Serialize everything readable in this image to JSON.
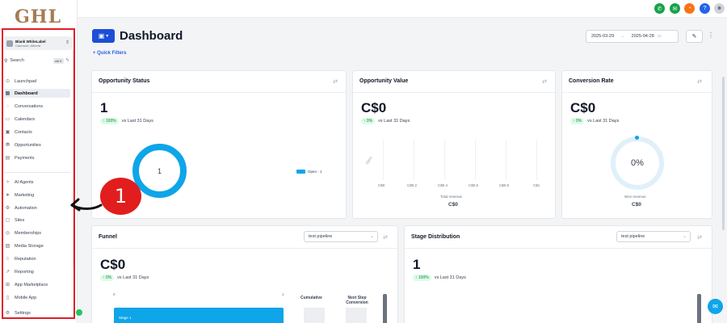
{
  "logo": "GHL",
  "callout": {
    "number": "1"
  },
  "account": {
    "name": "Blank WhiteLabel",
    "location": "Canmore, Alberta"
  },
  "search": {
    "label": "Search",
    "shortcut": "ctrl K"
  },
  "sidebar": {
    "items": [
      {
        "label": "Launchpad",
        "icon": "rocket-icon"
      },
      {
        "label": "Dashboard",
        "icon": "dashboard-icon",
        "active": true
      },
      {
        "label": "Conversations",
        "icon": "chat-icon"
      },
      {
        "label": "Calendars",
        "icon": "calendar-icon"
      },
      {
        "label": "Contacts",
        "icon": "contacts-icon"
      },
      {
        "label": "Opportunities",
        "icon": "opportunities-icon"
      },
      {
        "label": "Payments",
        "icon": "payments-icon"
      },
      {
        "label": "AI Agents",
        "icon": "ai-icon"
      },
      {
        "label": "Marketing",
        "icon": "send-icon"
      },
      {
        "label": "Automation",
        "icon": "automation-icon"
      },
      {
        "label": "Sites",
        "icon": "sites-icon"
      },
      {
        "label": "Memberships",
        "icon": "memberships-icon"
      },
      {
        "label": "Media Storage",
        "icon": "media-icon"
      },
      {
        "label": "Reputation",
        "icon": "star-icon"
      },
      {
        "label": "Reporting",
        "icon": "reporting-icon"
      },
      {
        "label": "App Marketplace",
        "icon": "marketplace-icon"
      },
      {
        "label": "Mobile App",
        "icon": "mobile-icon"
      },
      {
        "label": "Settings",
        "icon": "gear-icon"
      }
    ]
  },
  "topbar": {
    "buttons": [
      {
        "icon": "phone-icon",
        "color": "#16a34a",
        "glyph": "✆"
      },
      {
        "icon": "megaphone-icon",
        "color": "#16a34a",
        "glyph": "✉"
      },
      {
        "icon": "bell-icon",
        "color": "#f97316",
        "glyph": "🔔"
      },
      {
        "icon": "help-icon",
        "color": "#2563eb",
        "glyph": "?"
      },
      {
        "icon": "avatar-icon",
        "color": "#9ca3af",
        "glyph": "●"
      }
    ]
  },
  "header": {
    "title": "Dashboard",
    "date_from": "2025-03-29",
    "date_to": "2025-04-28",
    "quick_filters": "+ Quick Filters"
  },
  "cards": {
    "opportunity_status": {
      "title": "Opportunity Status",
      "value": "1",
      "trend": "↑ 100%",
      "trend_text": "vs Last 31 Days",
      "donut_value": "1",
      "legend": "Open - 1"
    },
    "opportunity_value": {
      "title": "Opportunity Value",
      "value": "C$0",
      "trend": "↑ 0%",
      "trend_text": "vs Last 31 Days",
      "y_label": "Open",
      "ticks": [
        "C$0",
        "C$0.2",
        "C$0.4",
        "C$0.6",
        "C$0.8",
        "C$1"
      ],
      "total_label": "Total revenue",
      "total_value": "C$0"
    },
    "conversion_rate": {
      "title": "Conversion Rate",
      "value": "C$0",
      "trend": "↑ 0%",
      "trend_text": "vs Last 31 Days",
      "gauge_value": "0%",
      "won_label": "Won revenue",
      "won_value": "C$0"
    },
    "funnel": {
      "title": "Funnel",
      "pipeline": "test pipeline",
      "value": "C$0",
      "trend": "↑ 0%",
      "trend_text": "vs Last 31 Days",
      "axis_min": "0",
      "axis_max": "1",
      "col_cumulative": "Cumulative",
      "col_next": "Next Step Conversion",
      "stage": "Stage 1"
    },
    "stage_distribution": {
      "title": "Stage Distribution",
      "pipeline": "test pipeline",
      "value": "1",
      "trend": "↑ 100%",
      "trend_text": "vs Last 31 Days"
    }
  },
  "colors": {
    "accent": "#1d4ed8",
    "donut": "#0ea5e9",
    "highlight": "#e11d2a",
    "positive": "#15803d"
  }
}
